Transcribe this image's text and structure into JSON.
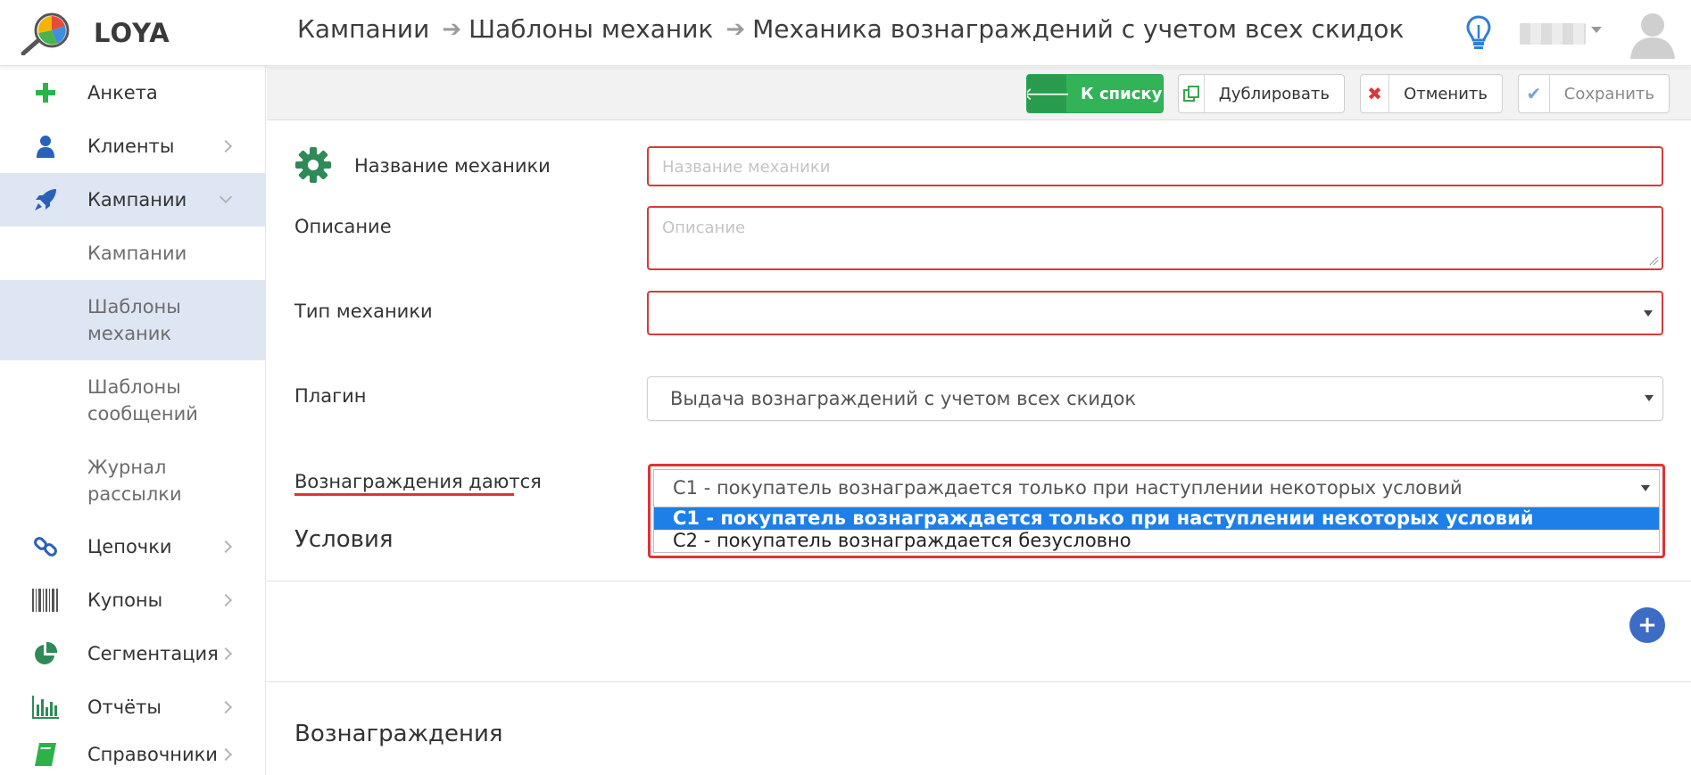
{
  "app": {
    "name": "LOYA"
  },
  "breadcrumb": [
    "Кампании",
    "Шаблоны механик",
    "Механика вознаграждений с учетом всех скидок"
  ],
  "sidebar": {
    "items": [
      {
        "label": "Анкета"
      },
      {
        "label": "Клиенты"
      },
      {
        "label": "Кампании"
      },
      {
        "label": "Цепочки"
      },
      {
        "label": "Купоны"
      },
      {
        "label": "Сегментация"
      },
      {
        "label": "Отчёты"
      },
      {
        "label": "Справочники"
      }
    ],
    "sub": [
      "Кампании",
      "Шаблоны механик",
      "Шаблоны сообщений",
      "Журнал рассылки"
    ]
  },
  "toolbar": {
    "back": "К списку",
    "duplicate": "Дублировать",
    "cancel": "Отменить",
    "save": "Сохранить"
  },
  "form": {
    "name_label": "Название механики",
    "name_placeholder": "Название механики",
    "desc_label": "Описание",
    "desc_placeholder": "Описание",
    "type_label": "Тип механики",
    "type_value": "",
    "plugin_label": "Плагин",
    "plugin_value": "Выдача вознаграждений с учетом всех скидок",
    "rewards_label": "Вознаграждения даются",
    "rewards_value": "С1 - покупатель вознаграждается только при наступлении некоторых условий",
    "rewards_options": [
      "С1 - покупатель вознаграждается только при наступлении некоторых условий",
      "С2 - покупатель вознаграждается безусловно"
    ]
  },
  "sections": {
    "conditions": "Условия",
    "rewards": "Вознаграждения"
  },
  "colors": {
    "accent_green": "#32b358",
    "error_red": "#d63a3a",
    "highlight_blue": "#1e7fe8",
    "active_nav_bg": "#dfe6f3"
  }
}
